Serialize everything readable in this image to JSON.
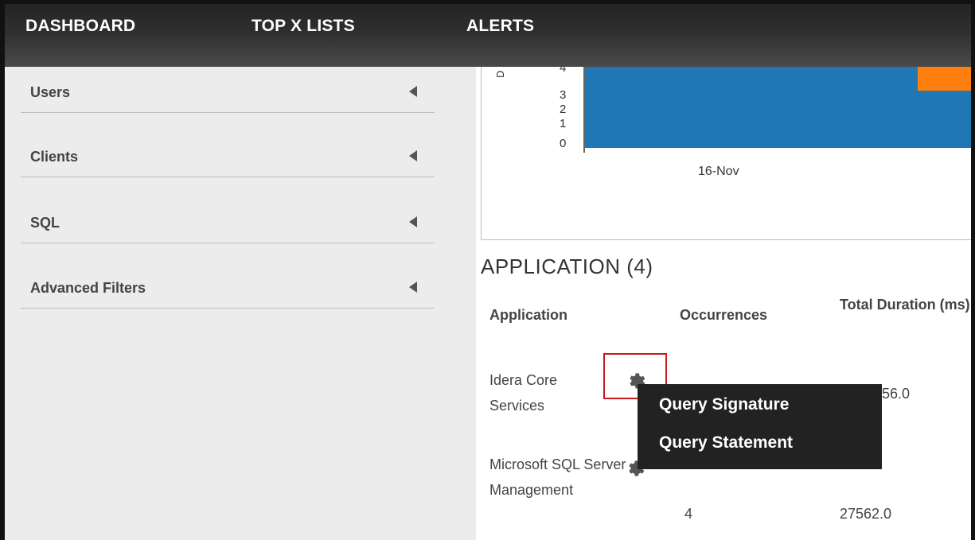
{
  "topnav": {
    "items": [
      {
        "label": "DASHBOARD"
      },
      {
        "label": "TOP X LISTS"
      },
      {
        "label": "ALERTS"
      }
    ]
  },
  "sidebar": {
    "items": [
      {
        "label": "Users"
      },
      {
        "label": "Clients"
      },
      {
        "label": "SQL"
      },
      {
        "label": "Advanced Filters"
      }
    ]
  },
  "chart_data": {
    "type": "bar",
    "categories": [
      "16-Nov"
    ],
    "ylabel": "",
    "y_ticks": [
      "0",
      "1",
      "2",
      "3",
      "4"
    ],
    "colors": {
      "series1": "#1f77b4",
      "series2": "#ff7f0e"
    }
  },
  "application": {
    "title": "APPLICATION (4)",
    "columns": [
      "Application",
      "Occurrences",
      "Total Duration (ms)"
    ],
    "rows": [
      {
        "application": "Idera Core Services",
        "occurrences": "",
        "total_duration": "56.0"
      },
      {
        "application": "Microsoft SQL Server Management",
        "occurrences": "4",
        "total_duration": "27562.0"
      }
    ]
  },
  "context_menu": {
    "items": [
      "Query Signature",
      "Query Statement"
    ]
  }
}
